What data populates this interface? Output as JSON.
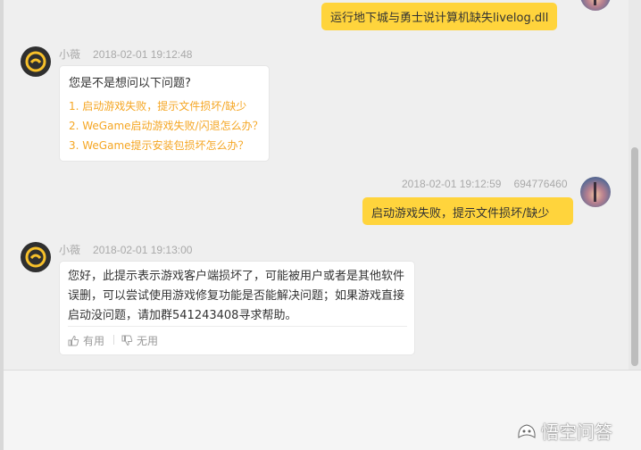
{
  "messages": {
    "top_user_msg": "运行地下城与勇士说计算机缺失livelog.dll",
    "bot1": {
      "name": "小薇",
      "time": "2018-02-01 19:12:48",
      "title": "您是不是想问以下问题?",
      "links": [
        "1. 启动游戏失败，提示文件损坏/缺少",
        "2. WeGame启动游戏失败/闪退怎么办？",
        "3. WeGame提示安装包损坏怎么办？"
      ]
    },
    "user1": {
      "time": "2018-02-01 19:12:59",
      "id": "694776460",
      "text": "启动游戏失败，提示文件损坏/缺少"
    },
    "bot2": {
      "name": "小薇",
      "time": "2018-02-01 19:13:00",
      "text": "您好，此提示表示游戏客户端损坏了，可能被用户或者是其他软件误删，可以尝试使用游戏修复功能是否能解决问题；如果游戏直接启动没问题，请加群541243408寻求帮助。",
      "useful": "有用",
      "useless": "无用"
    }
  },
  "watermark": "悟空问答",
  "colors": {
    "user_bubble": "#ffd43c",
    "link": "#f5a623",
    "meta": "#a9a9a9"
  }
}
